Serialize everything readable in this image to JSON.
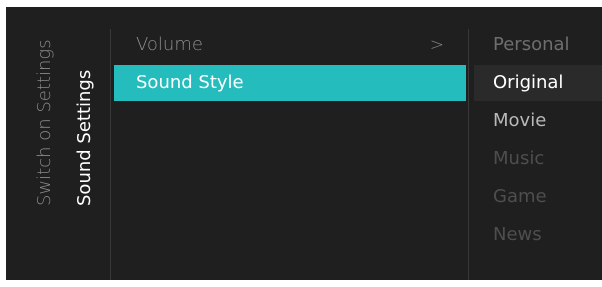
{
  "breadcrumb": {
    "parent": "Switch on Settings",
    "current": "Sound Settings"
  },
  "menu": {
    "items": [
      {
        "label": "Volume",
        "has_submenu": true,
        "chevron": ">"
      },
      {
        "label": "Sound Style",
        "selected": true
      }
    ]
  },
  "options": {
    "items": [
      {
        "label": "Personal",
        "state": "dim"
      },
      {
        "label": "Original",
        "state": "selected"
      },
      {
        "label": "Movie",
        "state": "enabled"
      },
      {
        "label": "Music",
        "state": "disabled"
      },
      {
        "label": "Game",
        "state": "disabled"
      },
      {
        "label": "News",
        "state": "disabled"
      }
    ]
  },
  "colors": {
    "background": "#1f1f1f",
    "accent": "#24bcbc",
    "text_active": "#ffffff",
    "text_inactive": "#8c8c8c"
  }
}
